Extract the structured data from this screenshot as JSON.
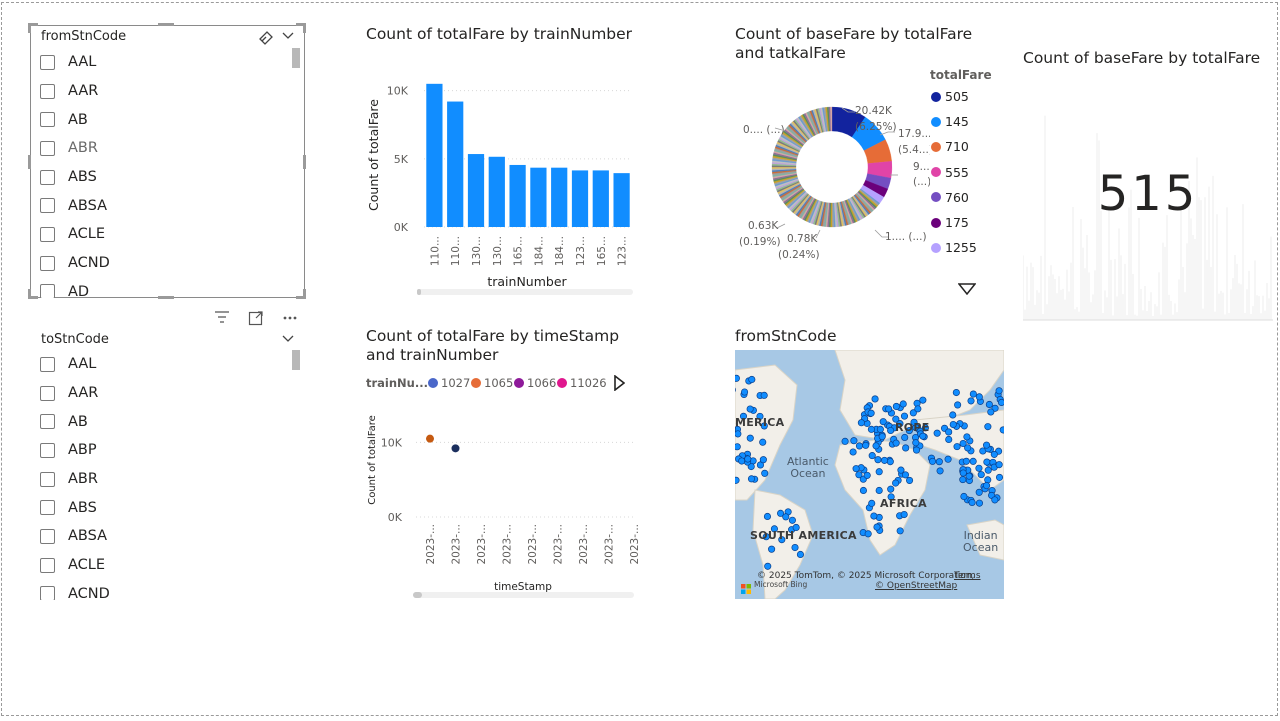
{
  "slicer_from": {
    "title": "fromStnCode",
    "items": [
      "AAL",
      "AAR",
      "AB",
      "ABR",
      "ABS",
      "ABSA",
      "ACLE",
      "ACND",
      "AD"
    ]
  },
  "slicer_to": {
    "title": "toStnCode",
    "items": [
      "AAL",
      "AAR",
      "AB",
      "ABP",
      "ABR",
      "ABS",
      "ABSA",
      "ACLE",
      "ACND"
    ]
  },
  "bar_visual": {
    "title": "Count of totalFare by trainNumber",
    "chart_data": {
      "type": "bar",
      "title": "Count of totalFare by trainNumber",
      "xlabel": "trainNumber",
      "ylabel": "Count of totalFare",
      "categories": [
        "110...",
        "110...",
        "130...",
        "130...",
        "165...",
        "184...",
        "184...",
        "123...",
        "165...",
        "123..."
      ],
      "values": [
        10500,
        9200,
        5350,
        5150,
        4550,
        4350,
        4350,
        4150,
        4150,
        3950
      ],
      "yticks": [
        "0K",
        "5K",
        "10K"
      ],
      "ylim": [
        0,
        11000
      ],
      "grid": true,
      "color": "#118dff"
    }
  },
  "donut_visual": {
    "title": "Count of baseFare by totalFare and tatkalFare",
    "legend_title": "totalFare",
    "legend": [
      {
        "label": "505",
        "color": "#12239e"
      },
      {
        "label": "145",
        "color": "#118dff"
      },
      {
        "label": "710",
        "color": "#e66c37"
      },
      {
        "label": "555",
        "color": "#e044a7"
      },
      {
        "label": "760",
        "color": "#744ec2"
      },
      {
        "label": "175",
        "color": "#6b007b"
      },
      {
        "label": "1255",
        "color": "#b5a1ff"
      }
    ],
    "labels": {
      "l1a": "20.42K",
      "l1b": "(6.25%)",
      "l2a": "17.9...",
      "l2b": "(5.4...)",
      "l3a": "9...",
      "l3b": "(...)",
      "l4": "1.... (...)",
      "l5a": "0.78K",
      "l5b": "(0.24%)",
      "l6a": "0.63K",
      "l6b": "(0.19%)",
      "l7": "0.... (...)"
    },
    "chart_data": {
      "type": "pie",
      "title": "Count of baseFare by totalFare and tatkalFare",
      "legend_title": "totalFare",
      "slices": [
        {
          "label": "505",
          "value": 20.42,
          "percent": 6.25,
          "color": "#12239e"
        },
        {
          "label": "145",
          "value": 17.9,
          "percent": 5.4,
          "color": "#118dff"
        },
        {
          "label": "710",
          "value": 9.0,
          "color": "#e66c37"
        },
        {
          "label": "555",
          "value": 6.0,
          "color": "#e044a7"
        },
        {
          "label": "760",
          "value": 4.0,
          "color": "#744ec2"
        },
        {
          "label": "175",
          "value": 3.0,
          "color": "#6b007b"
        },
        {
          "label": "1255",
          "value": 2.5,
          "color": "#b5a1ff"
        },
        {
          "label": "other",
          "value": 0.78,
          "percent": 0.24
        },
        {
          "label": "other",
          "value": 0.63,
          "percent": 0.19
        }
      ]
    }
  },
  "card_visual": {
    "title": "Count of baseFare by totalFare",
    "value": "515"
  },
  "scatter_visual": {
    "title_line1": "Count of totalFare by timeStamp",
    "title_line2": "and trainNumber",
    "legend_title": "trainNu...",
    "legend": [
      {
        "label": "1027",
        "color": "#4a67c9"
      },
      {
        "label": "1065",
        "color": "#e66c37"
      },
      {
        "label": "1066",
        "color": "#8e1a9a"
      },
      {
        "label": "11026",
        "color": "#e0178e"
      }
    ],
    "chart_data": {
      "type": "scatter",
      "title": "Count of totalFare by timeStamp and trainNumber",
      "xlabel": "timeStamp",
      "ylabel": "Count of totalFare",
      "xticks": [
        "2023-...",
        "2023-...",
        "2023-...",
        "2023-...",
        "2023-...",
        "2023-...",
        "2023-...",
        "2023-...",
        "2023-..."
      ],
      "yticks": [
        "0K",
        "10K"
      ],
      "ylim": [
        0,
        13000
      ],
      "points": [
        {
          "x_index": 0,
          "y": 10500,
          "color": "#c55a11"
        },
        {
          "x_index": 1,
          "y": 9200,
          "color": "#1c2f5e"
        }
      ]
    }
  },
  "map_visual": {
    "title": "fromStnCode",
    "labels": {
      "america": "MERICA",
      "europe": "ROPE",
      "atlantic1": "Atlantic",
      "atlantic2": "Ocean",
      "africa": "AFRICA",
      "south_america": "SOUTH AMERICA",
      "indian1": "Indian",
      "indian2": "Ocean"
    },
    "copyright": "© 2025 TomTom, © 2025 Microsoft Corporation,",
    "terms": "Terms",
    "osm": "© OpenStreetMap",
    "bing": "Microsoft Bing"
  }
}
